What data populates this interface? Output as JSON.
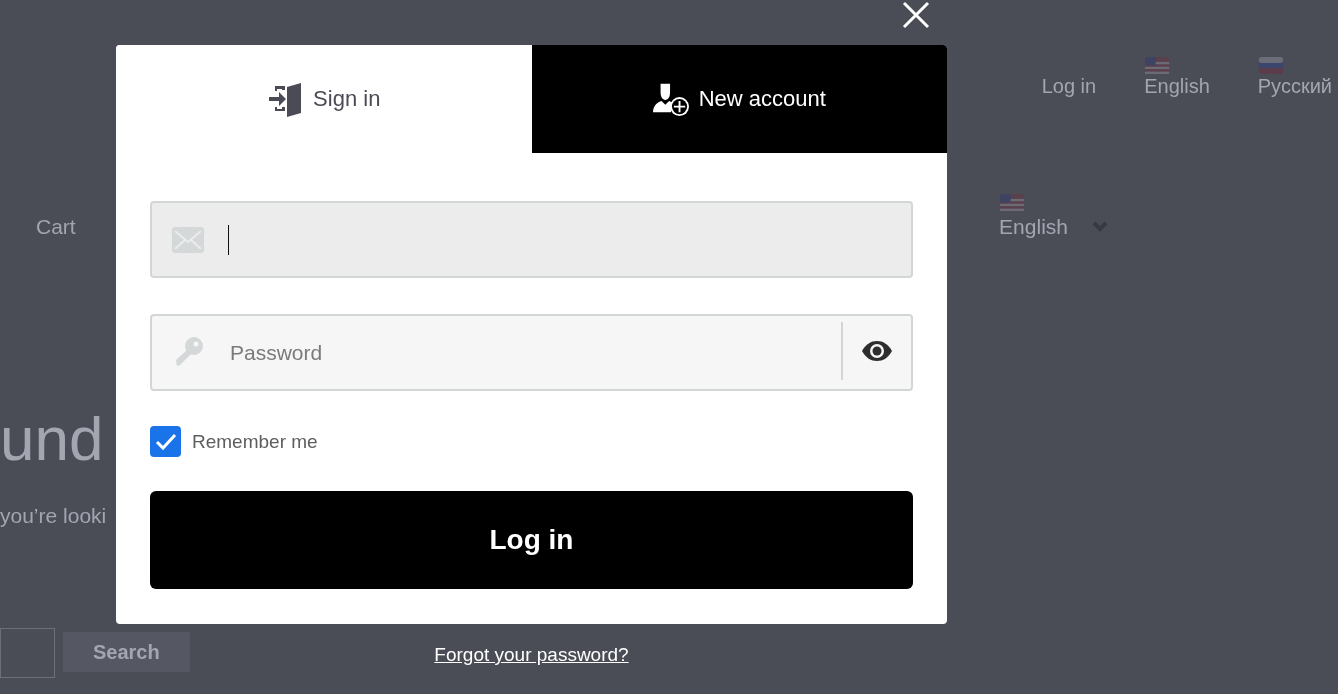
{
  "background_page": {
    "header_links": [
      {
        "kind": "plain",
        "label": "Log in"
      },
      {
        "kind": "flag-us",
        "label": "English"
      },
      {
        "kind": "flag-ru",
        "label": "Русский"
      }
    ],
    "cart_link": "Cart",
    "language_menu": {
      "kind": "flag-us",
      "label": "English"
    },
    "heading": "und",
    "text": "you’re looki",
    "search_button": "Search"
  },
  "dialog": {
    "tabs": [
      {
        "kind": "sign-in",
        "label": "Sign in",
        "selected": true
      },
      {
        "kind": "new-account",
        "label": "New account",
        "selected": false
      }
    ],
    "email_field": {
      "focused": true
    },
    "password_field": {
      "placeholder": "Password"
    },
    "remember": {
      "label": "Remember me",
      "checked": true
    },
    "submit_button": "Log in",
    "forgot_link": "Forgot your password?"
  }
}
